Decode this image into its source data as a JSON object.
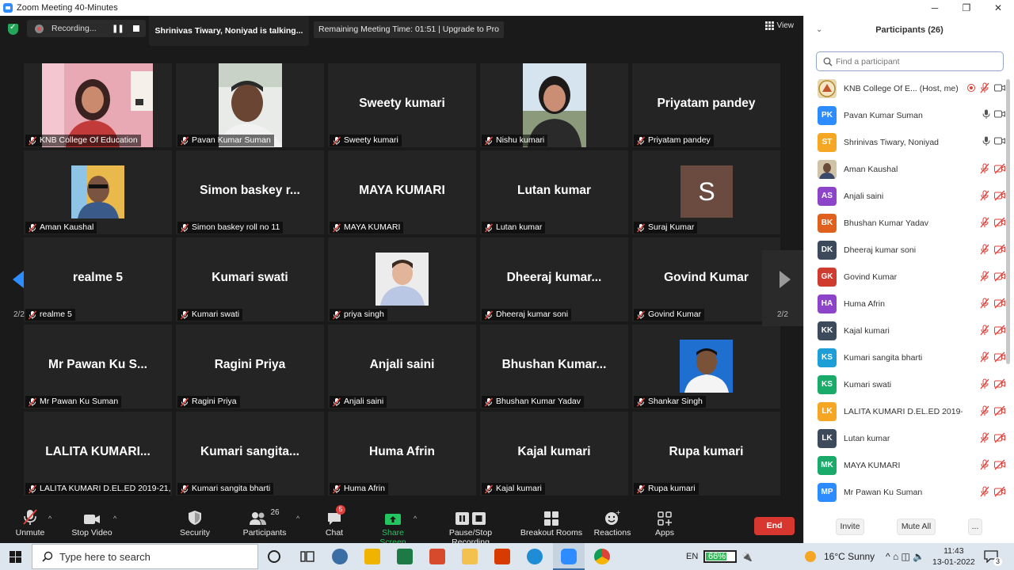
{
  "window": {
    "title": "Zoom Meeting 40-Minutes",
    "minimize": "─",
    "maximize": "❐",
    "close": "✕"
  },
  "topbar": {
    "recording_label": "Recording...",
    "pause_glyph": "❚❚",
    "talking": "Shrinivas Tiwary, Noniyad is talking...",
    "remaining": "Remaining Meeting Time: 01:51 | Upgrade to Pro",
    "view_label": "View"
  },
  "pager": {
    "left_label": "2/2",
    "right_label": "2/2"
  },
  "tiles": [
    {
      "label": "KNB College Of Education",
      "big": "",
      "type": "photo-woman"
    },
    {
      "label": "Pavan Kumar Suman",
      "big": "",
      "type": "photo-man"
    },
    {
      "label": "Sweety kumari",
      "big": "Sweety kumari",
      "type": "name"
    },
    {
      "label": "Nishu kumari",
      "big": "",
      "type": "photo-girl"
    },
    {
      "label": "Priyatam pandey",
      "big": "Priyatam pandey",
      "type": "name"
    },
    {
      "label": "Aman Kaushal",
      "big": "",
      "type": "photo-aman"
    },
    {
      "label": "Simon baskey roll no 11",
      "big": "Simon baskey r...",
      "type": "name"
    },
    {
      "label": "MAYA KUMARI",
      "big": "MAYA KUMARI",
      "type": "name"
    },
    {
      "label": "Lutan kumar",
      "big": "Lutan kumar",
      "type": "name"
    },
    {
      "label": "Suraj Kumar",
      "big": "S",
      "type": "letter"
    },
    {
      "label": "realme 5",
      "big": "realme 5",
      "type": "name"
    },
    {
      "label": "Kumari swati",
      "big": "Kumari swati",
      "type": "name"
    },
    {
      "label": "priya singh",
      "big": "",
      "type": "photo-boy"
    },
    {
      "label": "Dheeraj kumar soni",
      "big": "Dheeraj  kumar...",
      "type": "name"
    },
    {
      "label": "Govind Kumar",
      "big": "Govind Kumar",
      "type": "name"
    },
    {
      "label": "Mr  Pawan Ku Suman",
      "big": "Mr  Pawan Ku S...",
      "type": "name"
    },
    {
      "label": "Ragini  Priya",
      "big": "Ragini  Priya",
      "type": "name"
    },
    {
      "label": "Anjali saini",
      "big": "Anjali saini",
      "type": "name"
    },
    {
      "label": "Bhushan Kumar Yadav",
      "big": "Bhushan  Kumar...",
      "type": "name"
    },
    {
      "label": "Shankar Singh",
      "big": "",
      "type": "photo-shankar"
    },
    {
      "label": "LALITA KUMARI D.EL.ED 2019-21,...",
      "big": "LALITA  KUMARI...",
      "type": "name"
    },
    {
      "label": "Kumari sangita bharti",
      "big": "Kumari  sangita...",
      "type": "name"
    },
    {
      "label": "Huma Afrin",
      "big": "Huma Afrin",
      "type": "name"
    },
    {
      "label": "Kajal kumari",
      "big": "Kajal kumari",
      "type": "name"
    },
    {
      "label": "Rupa kumari",
      "big": "Rupa kumari",
      "type": "name"
    }
  ],
  "toolbar": {
    "unmute": "Unmute",
    "stop_video": "Stop Video",
    "security": "Security",
    "participants": "Participants",
    "participants_count": "26",
    "chat": "Chat",
    "chat_badge": "5",
    "share_screen": "Share Screen",
    "pause_recording": "Pause/Stop Recording",
    "breakout": "Breakout Rooms",
    "reactions": "Reactions",
    "apps": "Apps",
    "end": "End",
    "caret": "^"
  },
  "panel": {
    "title": "Participants (26)",
    "search_placeholder": "Find a participant",
    "invite": "Invite",
    "mute_all": "Mute All",
    "more": "...",
    "participants": [
      {
        "initials": "",
        "name": "KNB College Of E...  (Host, me)",
        "color": "#e8d8b0",
        "mic": "off",
        "video": "on",
        "logo": true
      },
      {
        "initials": "PK",
        "name": "Pavan Kumar Suman",
        "color": "#2d8cff",
        "mic": "on",
        "video": "on"
      },
      {
        "initials": "ST",
        "name": "Shrinivas Tiwary, Noniyad",
        "color": "#f5a623",
        "mic": "on",
        "video": "on"
      },
      {
        "initials": "",
        "name": "Aman Kaushal",
        "color": "#7a8a9a",
        "mic": "off",
        "video": "off",
        "photo": true
      },
      {
        "initials": "AS",
        "name": "Anjali saini",
        "color": "#8e44c9",
        "mic": "off",
        "video": "off"
      },
      {
        "initials": "BK",
        "name": "Bhushan Kumar Yadav",
        "color": "#e0601e",
        "mic": "off",
        "video": "off"
      },
      {
        "initials": "DK",
        "name": "Dheeraj kumar soni",
        "color": "#3d4a5c",
        "mic": "off",
        "video": "off"
      },
      {
        "initials": "GK",
        "name": "Govind Kumar",
        "color": "#d03b2f",
        "mic": "off",
        "video": "off"
      },
      {
        "initials": "HA",
        "name": "Huma Afrin",
        "color": "#8e44c9",
        "mic": "off",
        "video": "off"
      },
      {
        "initials": "KK",
        "name": "Kajal kumari",
        "color": "#3d4a5c",
        "mic": "off",
        "video": "off"
      },
      {
        "initials": "KS",
        "name": "Kumari sangita bharti",
        "color": "#1e9ed6",
        "mic": "off",
        "video": "off"
      },
      {
        "initials": "KS",
        "name": "Kumari swati",
        "color": "#1aab6a",
        "mic": "off",
        "video": "off"
      },
      {
        "initials": "LK",
        "name": "LALITA KUMARI D.EL.ED 2019-21...",
        "color": "#f5a623",
        "mic": "off",
        "video": "off"
      },
      {
        "initials": "LK",
        "name": "Lutan kumar",
        "color": "#3d4a5c",
        "mic": "off",
        "video": "off"
      },
      {
        "initials": "MK",
        "name": "MAYA KUMARI",
        "color": "#1aab6a",
        "mic": "off",
        "video": "off"
      },
      {
        "initials": "MP",
        "name": "Mr  Pawan Ku Suman",
        "color": "#2d8cff",
        "mic": "off",
        "video": "off"
      }
    ]
  },
  "taskbar": {
    "search_placeholder": "Type here to search",
    "lang": "EN",
    "battery": "66%",
    "weather": "16°C  Sunny",
    "time": "11:43",
    "date": "13-01-2022",
    "notifications": "3",
    "tray_glyphs": "^  ⌂  ◫  🔈"
  },
  "colors": {
    "accent": "#2d8cff",
    "end_red": "#d8372f",
    "share_green": "#23c55e",
    "mic_off_red": "#e0403a"
  }
}
